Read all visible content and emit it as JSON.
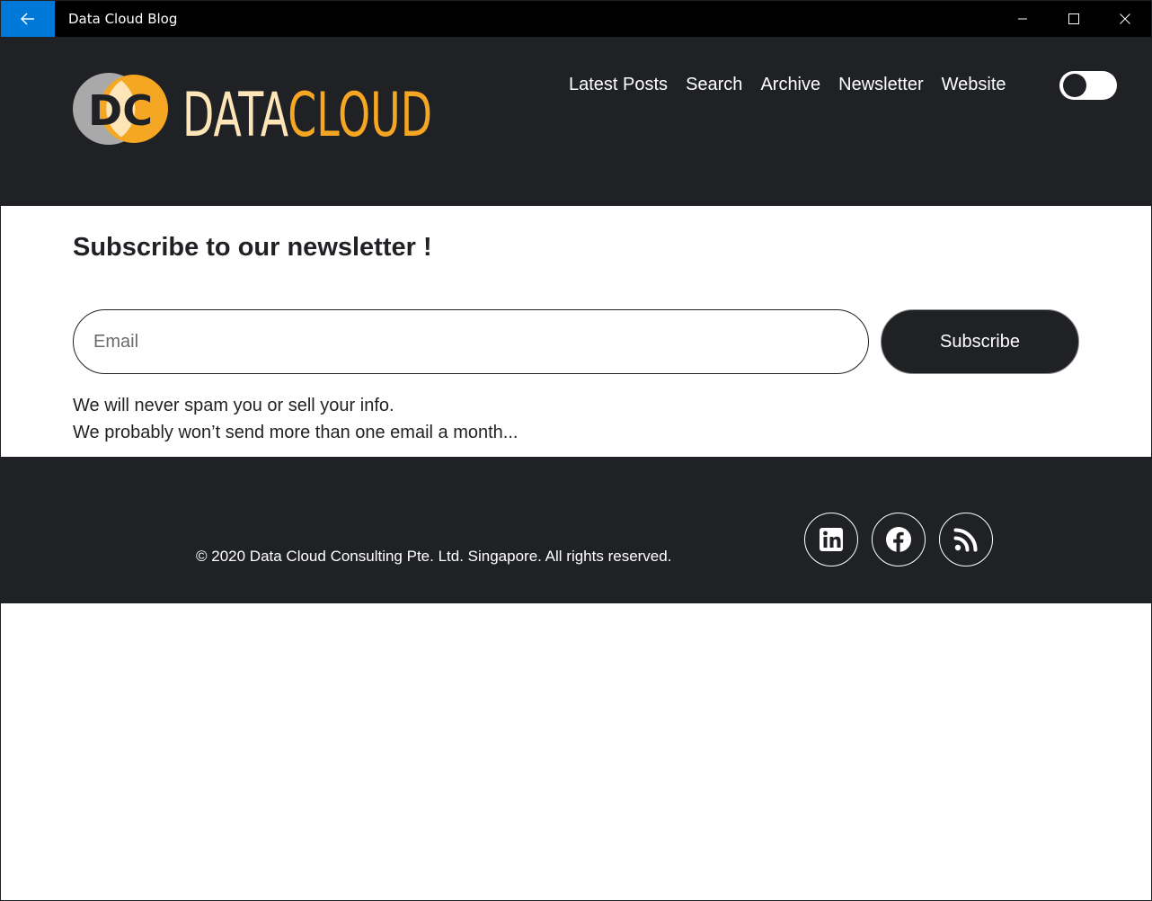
{
  "window": {
    "title": "Data Cloud Blog",
    "accent": "#0078d7",
    "controls": [
      "minimize-icon",
      "maximize-icon",
      "close-icon"
    ]
  },
  "header": {
    "logo": {
      "initials": "DC",
      "text_part1": "DATA",
      "text_part2": "CLOUD",
      "colors": {
        "gray": "#a9a9a9",
        "orange": "#f5a623",
        "cream": "#fde5b8"
      }
    },
    "nav": [
      "Latest Posts",
      "Search",
      "Archive",
      "Newsletter",
      "Website"
    ],
    "theme_toggle": {
      "state": "off"
    }
  },
  "newsletter": {
    "heading": "Subscribe to our newsletter !",
    "email_placeholder": "Email",
    "email_value": "",
    "subscribe_label": "Subscribe",
    "note_line1": "We will never spam you or sell your info.",
    "note_line2": "We probably won’t send more than one email a month..."
  },
  "footer": {
    "copyright": "© 2020 Data Cloud Consulting Pte. Ltd. Singapore. All rights reserved.",
    "social": [
      "linkedin-icon",
      "facebook-icon",
      "rss-icon"
    ]
  },
  "colors": {
    "dark": "#1f2124",
    "white": "#ffffff"
  }
}
